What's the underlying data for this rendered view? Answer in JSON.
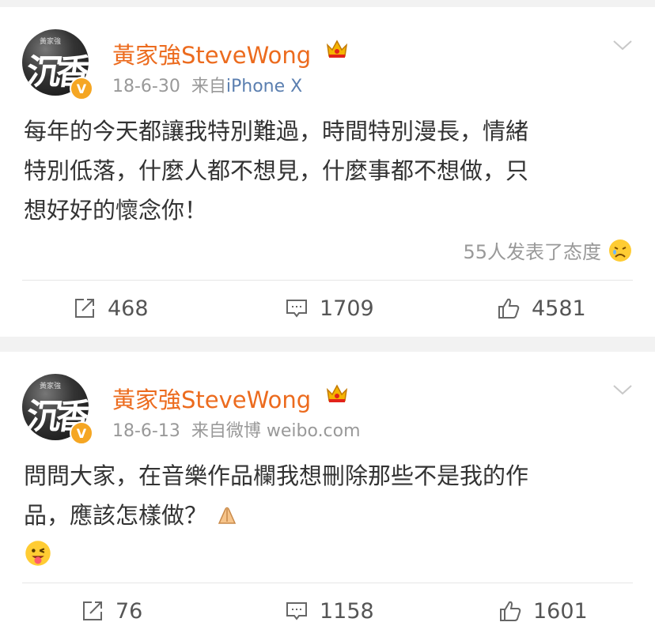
{
  "posts": [
    {
      "username": "黃家強SteveWong",
      "avatar_text": "沉香",
      "avatar_small_text": "黃家強",
      "date": "18-6-30",
      "source_prefix": "来自",
      "source_name": "iPhone X",
      "content_lines": [
        "每年的今天都讓我特別難過，時間特別漫長，情緒",
        "特別低落，什麼人都不想見，什麼事都不想做，只",
        "想好好的懷念你！"
      ],
      "reactions_text": "55人发表了态度",
      "reposts": "468",
      "comments": "1709",
      "likes": "4581"
    },
    {
      "username": "黃家強SteveWong",
      "avatar_text": "沉香",
      "avatar_small_text": "黃家強",
      "date": "18-6-13",
      "source_prefix": "来自",
      "source_name": "微博 weibo.com",
      "content_lines": [
        "問問大家，在音樂作品欄我想刪除那些不是我的作",
        "品，應該怎樣做？"
      ],
      "reposts": "76",
      "comments": "1158",
      "likes": "1601"
    }
  ],
  "icons": {
    "verified": "verified-v-badge",
    "crown": "crown-icon",
    "chevron": "chevron-down-icon",
    "repost": "repost-icon",
    "comment": "comment-icon",
    "like": "thumbs-up-icon"
  },
  "colors": {
    "username": "#ec6b1e",
    "source_link": "#5b7fb0",
    "meta": "#999999",
    "verified": "#f5a623"
  }
}
